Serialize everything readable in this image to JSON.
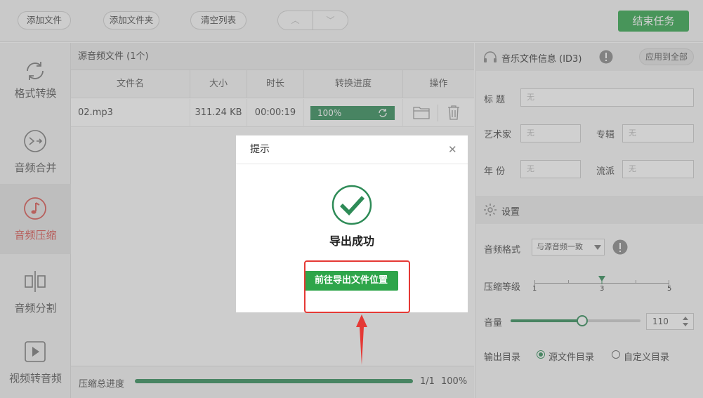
{
  "toolbar": {
    "add_file": "添加文件",
    "add_folder": "添加文件夹",
    "clear_list": "清空列表",
    "up_arrow": "︿",
    "down_arrow": "﹀",
    "end_task": "结束任务"
  },
  "sidebar": {
    "items": [
      {
        "label": "格式转换",
        "icon": "refresh-icon"
      },
      {
        "label": "音频合并",
        "icon": "merge-icon"
      },
      {
        "label": "音频压缩",
        "icon": "music-note-icon",
        "active": true
      },
      {
        "label": "音频分割",
        "icon": "split-icon"
      },
      {
        "label": "视频转音频",
        "icon": "play-icon"
      }
    ]
  },
  "file_list": {
    "header": "源音频文件 (1个)",
    "columns": [
      "文件名",
      "大小",
      "时长",
      "转换进度",
      "操作"
    ],
    "rows": [
      {
        "name": "02.mp3",
        "size": "311.24 KB",
        "duration": "00:00:19",
        "progress": "100%",
        "progress_value": 100
      }
    ]
  },
  "bottom": {
    "label": "压缩总进度",
    "count": "1/1",
    "percent": "100%",
    "progress_value": 100
  },
  "id3": {
    "title": "音乐文件信息 (ID3)",
    "apply_all": "应用到全部",
    "title_label": "标    题",
    "artist_label": "艺术家",
    "album_label": "专辑",
    "year_label": "年    份",
    "genre_label": "流派",
    "placeholder": "无"
  },
  "settings": {
    "title": "设置",
    "format_label": "音频格式",
    "format_value": "与源音频一致",
    "level_label": "压缩等级",
    "level_min": "1",
    "level_mid": "3",
    "level_max": "5",
    "level_value": 3,
    "volume_label": "音量",
    "volume_value": "110",
    "volume_fraction": 0.55,
    "output_label": "输出目录",
    "output_source": "源文件目录",
    "output_custom": "自定义目录"
  },
  "dialog": {
    "title": "提示",
    "message": "导出成功",
    "button": "前往导出文件位置",
    "close": "✕"
  },
  "colors": {
    "accent": "#2ea54a",
    "active_nav": "#d9534f",
    "annotation": "#e53935"
  }
}
